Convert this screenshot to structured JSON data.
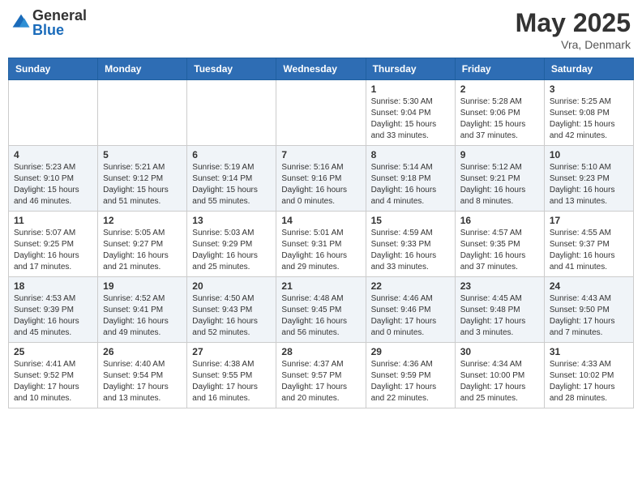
{
  "header": {
    "logo_general": "General",
    "logo_blue": "Blue",
    "month_year": "May 2025",
    "location": "Vra, Denmark"
  },
  "weekdays": [
    "Sunday",
    "Monday",
    "Tuesday",
    "Wednesday",
    "Thursday",
    "Friday",
    "Saturday"
  ],
  "weeks": [
    [
      {
        "day": "",
        "info": ""
      },
      {
        "day": "",
        "info": ""
      },
      {
        "day": "",
        "info": ""
      },
      {
        "day": "",
        "info": ""
      },
      {
        "day": "1",
        "info": "Sunrise: 5:30 AM\nSunset: 9:04 PM\nDaylight: 15 hours\nand 33 minutes."
      },
      {
        "day": "2",
        "info": "Sunrise: 5:28 AM\nSunset: 9:06 PM\nDaylight: 15 hours\nand 37 minutes."
      },
      {
        "day": "3",
        "info": "Sunrise: 5:25 AM\nSunset: 9:08 PM\nDaylight: 15 hours\nand 42 minutes."
      }
    ],
    [
      {
        "day": "4",
        "info": "Sunrise: 5:23 AM\nSunset: 9:10 PM\nDaylight: 15 hours\nand 46 minutes."
      },
      {
        "day": "5",
        "info": "Sunrise: 5:21 AM\nSunset: 9:12 PM\nDaylight: 15 hours\nand 51 minutes."
      },
      {
        "day": "6",
        "info": "Sunrise: 5:19 AM\nSunset: 9:14 PM\nDaylight: 15 hours\nand 55 minutes."
      },
      {
        "day": "7",
        "info": "Sunrise: 5:16 AM\nSunset: 9:16 PM\nDaylight: 16 hours\nand 0 minutes."
      },
      {
        "day": "8",
        "info": "Sunrise: 5:14 AM\nSunset: 9:18 PM\nDaylight: 16 hours\nand 4 minutes."
      },
      {
        "day": "9",
        "info": "Sunrise: 5:12 AM\nSunset: 9:21 PM\nDaylight: 16 hours\nand 8 minutes."
      },
      {
        "day": "10",
        "info": "Sunrise: 5:10 AM\nSunset: 9:23 PM\nDaylight: 16 hours\nand 13 minutes."
      }
    ],
    [
      {
        "day": "11",
        "info": "Sunrise: 5:07 AM\nSunset: 9:25 PM\nDaylight: 16 hours\nand 17 minutes."
      },
      {
        "day": "12",
        "info": "Sunrise: 5:05 AM\nSunset: 9:27 PM\nDaylight: 16 hours\nand 21 minutes."
      },
      {
        "day": "13",
        "info": "Sunrise: 5:03 AM\nSunset: 9:29 PM\nDaylight: 16 hours\nand 25 minutes."
      },
      {
        "day": "14",
        "info": "Sunrise: 5:01 AM\nSunset: 9:31 PM\nDaylight: 16 hours\nand 29 minutes."
      },
      {
        "day": "15",
        "info": "Sunrise: 4:59 AM\nSunset: 9:33 PM\nDaylight: 16 hours\nand 33 minutes."
      },
      {
        "day": "16",
        "info": "Sunrise: 4:57 AM\nSunset: 9:35 PM\nDaylight: 16 hours\nand 37 minutes."
      },
      {
        "day": "17",
        "info": "Sunrise: 4:55 AM\nSunset: 9:37 PM\nDaylight: 16 hours\nand 41 minutes."
      }
    ],
    [
      {
        "day": "18",
        "info": "Sunrise: 4:53 AM\nSunset: 9:39 PM\nDaylight: 16 hours\nand 45 minutes."
      },
      {
        "day": "19",
        "info": "Sunrise: 4:52 AM\nSunset: 9:41 PM\nDaylight: 16 hours\nand 49 minutes."
      },
      {
        "day": "20",
        "info": "Sunrise: 4:50 AM\nSunset: 9:43 PM\nDaylight: 16 hours\nand 52 minutes."
      },
      {
        "day": "21",
        "info": "Sunrise: 4:48 AM\nSunset: 9:45 PM\nDaylight: 16 hours\nand 56 minutes."
      },
      {
        "day": "22",
        "info": "Sunrise: 4:46 AM\nSunset: 9:46 PM\nDaylight: 17 hours\nand 0 minutes."
      },
      {
        "day": "23",
        "info": "Sunrise: 4:45 AM\nSunset: 9:48 PM\nDaylight: 17 hours\nand 3 minutes."
      },
      {
        "day": "24",
        "info": "Sunrise: 4:43 AM\nSunset: 9:50 PM\nDaylight: 17 hours\nand 7 minutes."
      }
    ],
    [
      {
        "day": "25",
        "info": "Sunrise: 4:41 AM\nSunset: 9:52 PM\nDaylight: 17 hours\nand 10 minutes."
      },
      {
        "day": "26",
        "info": "Sunrise: 4:40 AM\nSunset: 9:54 PM\nDaylight: 17 hours\nand 13 minutes."
      },
      {
        "day": "27",
        "info": "Sunrise: 4:38 AM\nSunset: 9:55 PM\nDaylight: 17 hours\nand 16 minutes."
      },
      {
        "day": "28",
        "info": "Sunrise: 4:37 AM\nSunset: 9:57 PM\nDaylight: 17 hours\nand 20 minutes."
      },
      {
        "day": "29",
        "info": "Sunrise: 4:36 AM\nSunset: 9:59 PM\nDaylight: 17 hours\nand 22 minutes."
      },
      {
        "day": "30",
        "info": "Sunrise: 4:34 AM\nSunset: 10:00 PM\nDaylight: 17 hours\nand 25 minutes."
      },
      {
        "day": "31",
        "info": "Sunrise: 4:33 AM\nSunset: 10:02 PM\nDaylight: 17 hours\nand 28 minutes."
      }
    ]
  ]
}
